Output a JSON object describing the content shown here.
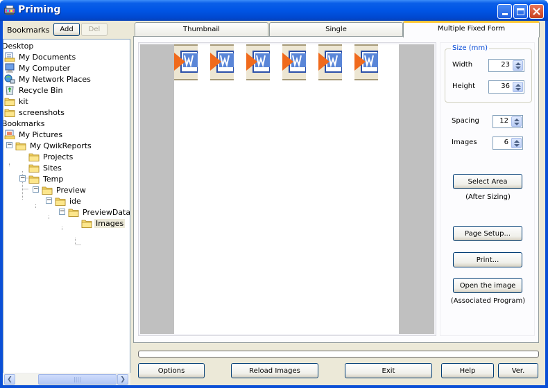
{
  "window": {
    "title": "Priming",
    "title_display": "Priming",
    "controls": {
      "minimize": "minimize-icon",
      "maximize": "maximize-icon",
      "close": "close-icon"
    }
  },
  "bookmarks": {
    "label": "Bookmarks",
    "add_label": "Add",
    "del_label": "Del"
  },
  "tree": {
    "items": [
      {
        "label": "Desktop",
        "icon": "none"
      },
      {
        "label": "My Documents",
        "icon": "documents-icon"
      },
      {
        "label": "My Computer",
        "icon": "computer-icon"
      },
      {
        "label": "My Network Places",
        "icon": "network-icon"
      },
      {
        "label": "Recycle Bin",
        "icon": "recycle-bin-icon"
      },
      {
        "label": "kit",
        "icon": "folder-icon"
      },
      {
        "label": "screenshots",
        "icon": "folder-icon"
      },
      {
        "label": "Bookmarks",
        "icon": "none"
      },
      {
        "label": "My Pictures",
        "icon": "pictures-icon"
      },
      {
        "label": "My QwikReports",
        "icon": "folder-icon",
        "expanded": true
      },
      {
        "label": "Projects",
        "icon": "folder-icon"
      },
      {
        "label": "Sites",
        "icon": "folder-icon"
      },
      {
        "label": "Temp",
        "icon": "folder-icon",
        "expanded": true
      },
      {
        "label": "Preview",
        "icon": "folder-icon",
        "expanded": true
      },
      {
        "label": "ide",
        "icon": "folder-icon",
        "expanded": true
      },
      {
        "label": "PreviewData",
        "icon": "folder-icon",
        "expanded": true
      },
      {
        "label": "Images",
        "icon": "folder-icon",
        "selected": true
      }
    ]
  },
  "tabs": [
    {
      "label": "Thumbnail",
      "active": false
    },
    {
      "label": "Single",
      "active": false
    },
    {
      "label": "Multiple Fixed Form",
      "active": true
    }
  ],
  "preview": {
    "image_count": 6,
    "image_icon": "word-document-icon"
  },
  "settings": {
    "size_group_label": "Size (mm)",
    "width_label": "Width",
    "width_value": "23",
    "height_label": "Height",
    "height_value": "36",
    "spacing_label": "Spacing",
    "spacing_value": "12",
    "images_label": "Images",
    "images_value": "6",
    "select_area_label": "Select Area",
    "select_area_note": "(After Sizing)",
    "page_setup_label": "Page Setup...",
    "print_label": "Print...",
    "open_image_label": "Open the image",
    "open_image_note": "(Associated Program)"
  },
  "progress": {
    "value_percent": 0
  },
  "footer": {
    "options_label": "Options",
    "reload_label": "Reload Images",
    "exit_label": "Exit",
    "help_label": "Help",
    "ver_label": "Ver."
  }
}
